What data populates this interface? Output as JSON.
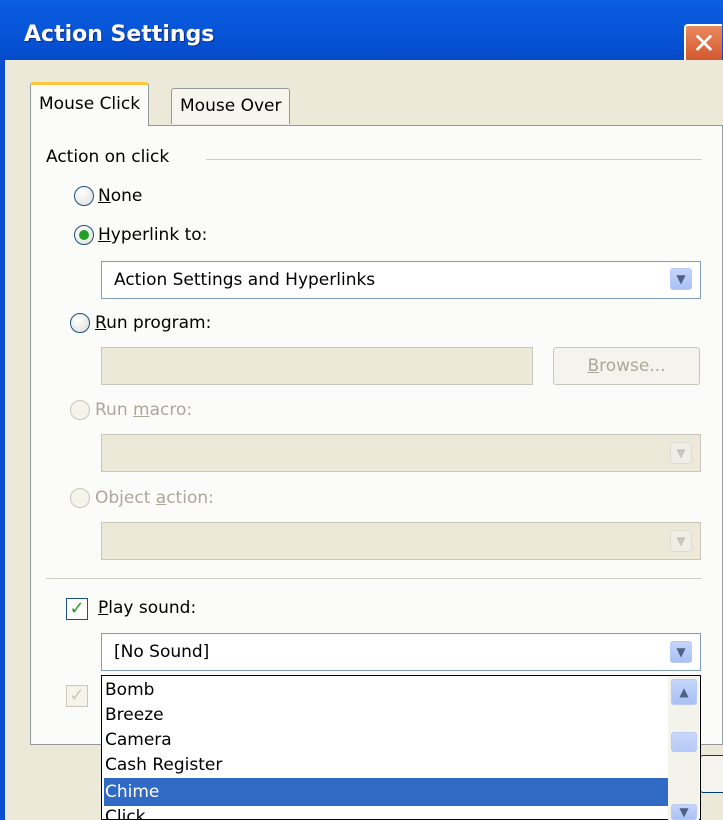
{
  "window": {
    "title": "Action Settings",
    "close_glyph": "✕"
  },
  "tabs": [
    {
      "label": "Mouse Click"
    },
    {
      "label": "Mouse Over"
    }
  ],
  "group": {
    "label": "Action on click"
  },
  "options": {
    "none": {
      "accel": "N",
      "rest": "one"
    },
    "hyperlink": {
      "accel": "H",
      "rest": "yperlink to:",
      "value": "Action Settings and Hyperlinks"
    },
    "run_program": {
      "accel": "R",
      "rest": "un program:",
      "value": ""
    },
    "browse": {
      "accel": "B",
      "rest": "rowse..."
    },
    "run_macro": {
      "pre": "Run ",
      "accel": "m",
      "rest": "acro:"
    },
    "object_action": {
      "pre": "Object ",
      "accel": "a",
      "rest": "ction:"
    }
  },
  "play_sound": {
    "accel": "P",
    "rest": "lay sound:",
    "checked": true,
    "value": "[No Sound]"
  },
  "sound_list": {
    "items": [
      "Bomb",
      "Breeze",
      "Camera",
      "Cash Register",
      "Chime",
      "Click"
    ],
    "selected": "Chime"
  },
  "icons": {
    "dropdown": "chevron-down-icon",
    "scroll_up": "chevron-up-icon",
    "check": "checkmark-icon"
  },
  "colors": {
    "titlebar": "#0053d6",
    "selection": "#316ac5",
    "radio_dot": "#21a121"
  }
}
